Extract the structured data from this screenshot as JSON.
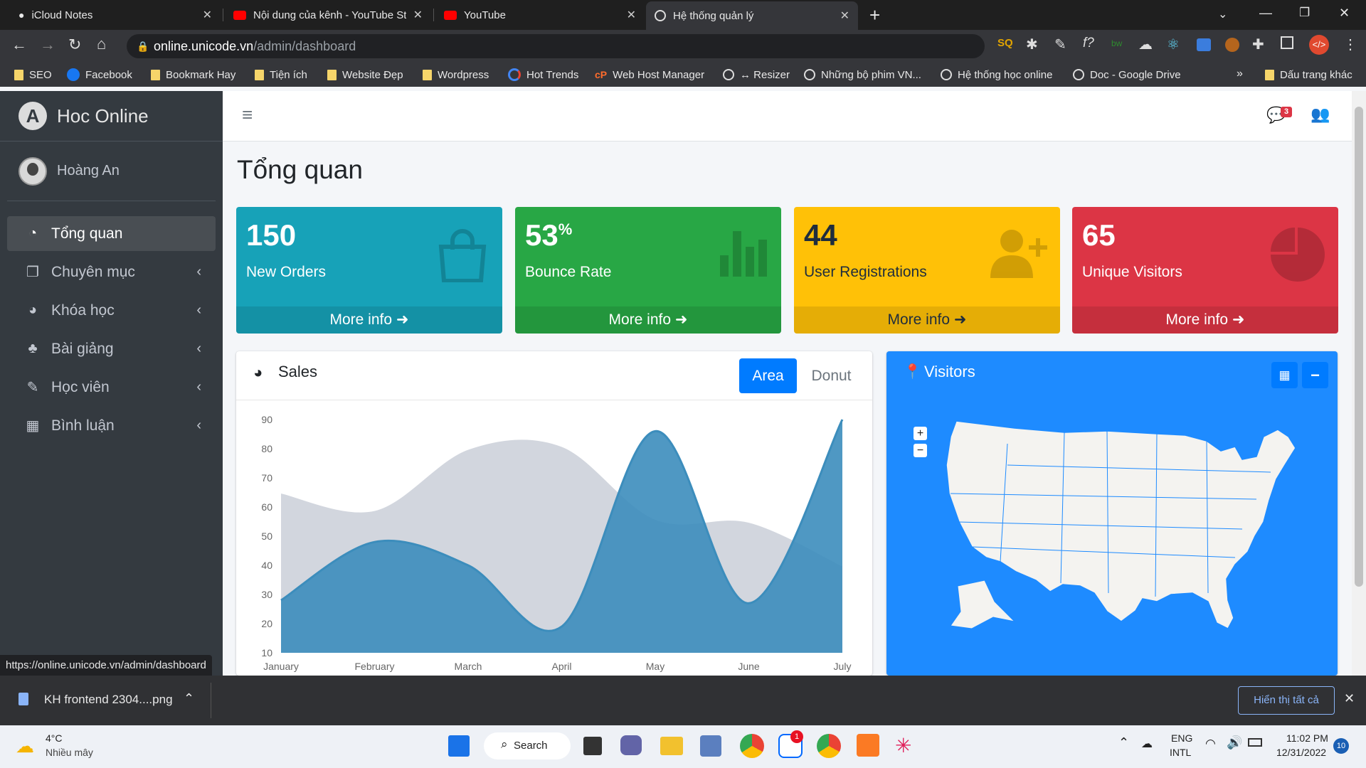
{
  "browser": {
    "tabs": [
      {
        "title": "iCloud Notes"
      },
      {
        "title": "Nội dung của kênh - YouTube Studio"
      },
      {
        "title": "YouTube"
      },
      {
        "title": "Hệ thống quản lý"
      }
    ],
    "url_domain": "online.unicode.vn",
    "url_path": "/admin/dashboard",
    "bookmarks": [
      "SEO",
      "Facebook",
      "Bookmark Hay",
      "Tiện ích",
      "Website Đẹp",
      "Wordpress",
      "Hot Trends",
      "Web Host Manager",
      "↔ Resizer",
      "Những bộ phim VN...",
      "Hệ thống học online",
      "Doc - Google Drive"
    ],
    "other_bookmarks": "Dấu trang khác",
    "status_url": "https://online.unicode.vn/admin/dashboard"
  },
  "sidebar": {
    "brand": "Hoc Online",
    "user_name": "Hoàng An",
    "items": [
      {
        "label": "Tổng quan"
      },
      {
        "label": "Chuyên mục"
      },
      {
        "label": "Khóa học"
      },
      {
        "label": "Bài giảng"
      },
      {
        "label": "Học viên"
      },
      {
        "label": "Bình luận"
      }
    ]
  },
  "header": {
    "notification_count": "3"
  },
  "page": {
    "title": "Tổng quan"
  },
  "stats": [
    {
      "value": "150",
      "unit": "",
      "label": "New Orders",
      "more": "More info",
      "color": "#17a2b8"
    },
    {
      "value": "53",
      "unit": "%",
      "label": "Bounce Rate",
      "more": "More info",
      "color": "#28a745"
    },
    {
      "value": "44",
      "unit": "",
      "label": "User Registrations",
      "more": "More info",
      "color": "#ffc107"
    },
    {
      "value": "65",
      "unit": "",
      "label": "Unique Visitors",
      "more": "More info",
      "color": "#dc3545"
    }
  ],
  "sales": {
    "title": "Sales",
    "tab_area": "Area",
    "tab_donut": "Donut"
  },
  "visitors": {
    "title": "Visitors",
    "zoom_in": "+",
    "zoom_out": "−"
  },
  "chart_data": {
    "type": "area",
    "title": "Sales",
    "categories": [
      "January",
      "February",
      "March",
      "April",
      "May",
      "June",
      "July"
    ],
    "ylim": [
      10,
      90
    ],
    "yticks": [
      10,
      20,
      30,
      40,
      50,
      60,
      70,
      80,
      90
    ],
    "series": [
      {
        "values": [
          65,
          59,
          80,
          81,
          56,
          55,
          40
        ],
        "color": "#d2d6de"
      },
      {
        "values": [
          28,
          48,
          40,
          19,
          86,
          27,
          90
        ],
        "color": "#3c8dbc"
      }
    ],
    "grid": false
  },
  "downloads": {
    "file": "KH frontend 2304....png",
    "show_all": "Hiển thị tất cả"
  },
  "taskbar": {
    "weather_temp": "4°C",
    "weather_desc": "Nhiều mây",
    "search": "Search",
    "lang1": "ENG",
    "lang2": "INTL",
    "time": "11:02 PM",
    "date": "12/31/2022",
    "notif": "10",
    "zalo_badge": "1"
  }
}
